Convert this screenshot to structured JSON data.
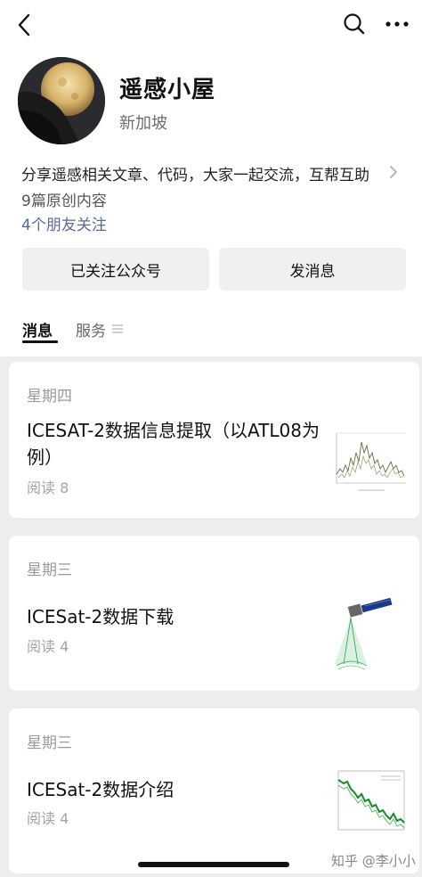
{
  "profile": {
    "name": "遥感小屋",
    "location": "新加坡",
    "description": "分享遥感相关文章、代码，大家一起交流，互帮互助",
    "original_count": "9篇原创内容",
    "friends_following": "4个朋友关注"
  },
  "actions": {
    "follow_label": "已关注公众号",
    "message_label": "发消息"
  },
  "tabs": [
    {
      "label": "消息",
      "active": true
    },
    {
      "label": "服务",
      "active": false
    }
  ],
  "articles": [
    {
      "day": "星期四",
      "title": "ICESAT-2数据信息提取（以ATL08为例）",
      "reads": "阅读 8",
      "thumb_icon": "line-chart-thumbnail"
    },
    {
      "day": "星期三",
      "title": "ICESat-2数据下载",
      "reads": "阅读 4",
      "thumb_icon": "satellite-thumbnail"
    },
    {
      "day": "星期三",
      "title": "ICESat-2数据介绍",
      "reads": "阅读 4",
      "thumb_icon": "scatter-chart-thumbnail"
    }
  ],
  "watermark": "知乎 @李小小",
  "colors": {
    "link": "#576b95",
    "background": "#ededed",
    "chart_green": "#1a8a2a"
  }
}
